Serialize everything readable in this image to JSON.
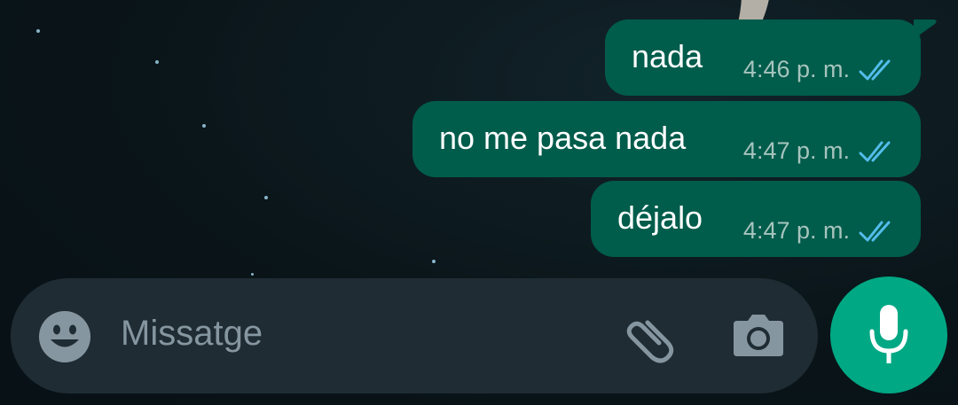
{
  "colors": {
    "bubble_outgoing": "#005c4b",
    "input_background": "#1f2c33",
    "accent_green": "#00a884",
    "read_ticks": "#53bdeb",
    "icon_gray": "#8696a0"
  },
  "messages": [
    {
      "text": "nada",
      "time": "4:46 p. m.",
      "status_icon": "double-check-read-icon"
    },
    {
      "text": "no me pasa nada",
      "time": "4:47 p. m.",
      "status_icon": "double-check-read-icon"
    },
    {
      "text": "déjalo",
      "time": "4:47 p. m.",
      "status_icon": "double-check-read-icon"
    }
  ],
  "composer": {
    "placeholder": "Missatge",
    "emoji_icon": "emoji-icon",
    "attach_icon": "paperclip-icon",
    "camera_icon": "camera-icon",
    "mic_icon": "microphone-icon"
  }
}
